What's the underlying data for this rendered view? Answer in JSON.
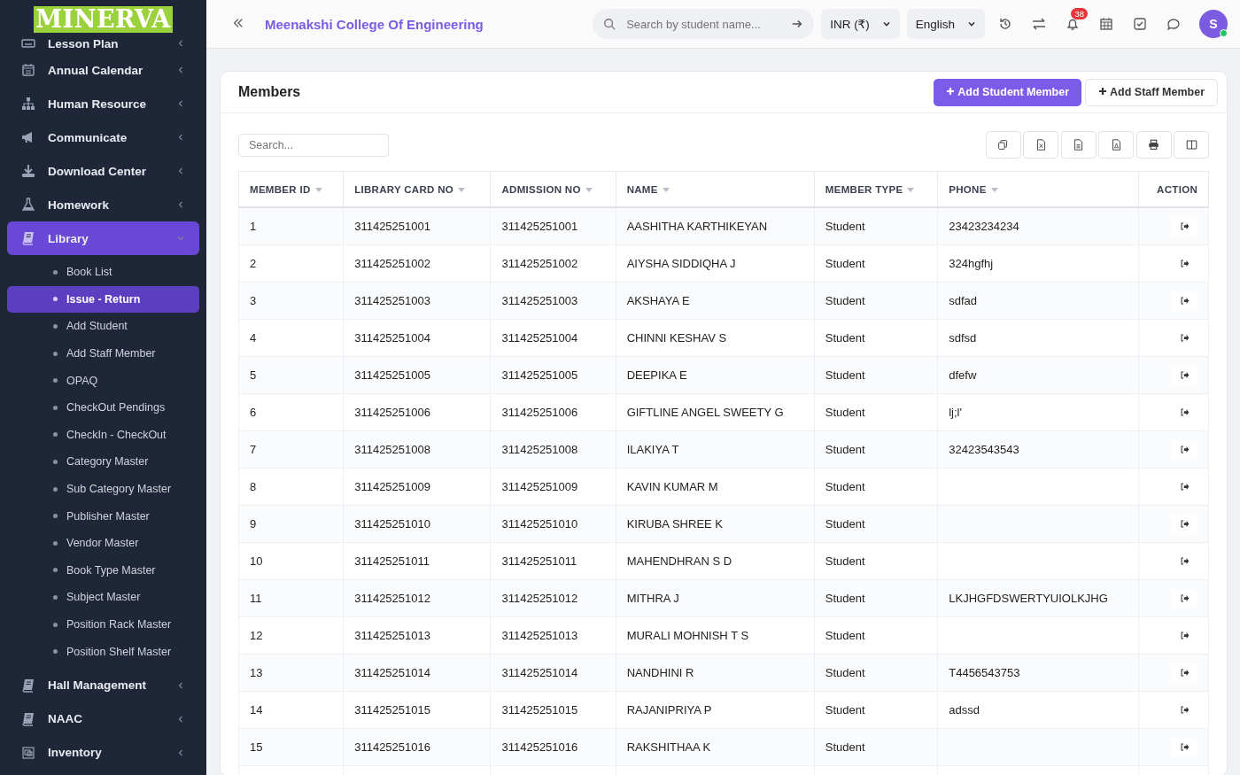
{
  "sidebar": {
    "logo": "MINERVA",
    "items": [
      {
        "label": "Lesson Plan",
        "expanded": false,
        "selected": false
      },
      {
        "label": "Annual Calendar",
        "expanded": false,
        "selected": false
      },
      {
        "label": "Human Resource",
        "expanded": false,
        "selected": false
      },
      {
        "label": "Communicate",
        "expanded": false,
        "selected": false
      },
      {
        "label": "Download Center",
        "expanded": false,
        "selected": false
      },
      {
        "label": "Homework",
        "expanded": false,
        "selected": false
      },
      {
        "label": "Library",
        "expanded": true,
        "selected": true,
        "children": [
          {
            "label": "Book List",
            "selected": false
          },
          {
            "label": "Issue - Return",
            "selected": true
          },
          {
            "label": "Add Student",
            "selected": false
          },
          {
            "label": "Add Staff Member",
            "selected": false
          },
          {
            "label": "OPAQ",
            "selected": false
          },
          {
            "label": "CheckOut Pendings",
            "selected": false
          },
          {
            "label": "CheckIn - CheckOut",
            "selected": false
          },
          {
            "label": "Category Master",
            "selected": false
          },
          {
            "label": "Sub Category Master",
            "selected": false
          },
          {
            "label": "Publisher Master",
            "selected": false
          },
          {
            "label": "Vendor Master",
            "selected": false
          },
          {
            "label": "Book Type Master",
            "selected": false
          },
          {
            "label": "Subject Master",
            "selected": false
          },
          {
            "label": "Position Rack Master",
            "selected": false
          },
          {
            "label": "Position Shelf Master",
            "selected": false
          }
        ]
      },
      {
        "label": "Hall Management",
        "expanded": false,
        "selected": false
      },
      {
        "label": "NAAC",
        "expanded": false,
        "selected": false
      },
      {
        "label": "Inventory",
        "expanded": false,
        "selected": false
      }
    ]
  },
  "topbar": {
    "title": "Meenakshi College Of Engineering",
    "search": {
      "placeholder": "Search by student name..."
    },
    "currency": "INR (₹)",
    "language": "English",
    "notifications": "38",
    "avatar": "S"
  },
  "card": {
    "title": "Members",
    "buttons": [
      {
        "label": "Add Student Member",
        "kind": "primary"
      },
      {
        "label": "Add Staff Member",
        "kind": "secondary"
      }
    ],
    "search": {
      "placeholder": "Search..."
    },
    "table": {
      "columns": [
        {
          "label": "MEMBER ID",
          "sortable": true
        },
        {
          "label": "LIBRARY CARD NO",
          "sortable": true
        },
        {
          "label": "ADMISSION NO",
          "sortable": true
        },
        {
          "label": "NAME",
          "sortable": true
        },
        {
          "label": "MEMBER TYPE",
          "sortable": true
        },
        {
          "label": "PHONE",
          "sortable": true
        },
        {
          "label": "ACTION",
          "sortable": false
        }
      ],
      "rows": [
        [
          "1",
          "311425251001",
          "311425251001",
          "AASHITHA KARTHIKEYAN",
          "Student",
          "23423234234"
        ],
        [
          "2",
          "311425251002",
          "311425251002",
          "AIYSHA SIDDIQHA J",
          "Student",
          "324hgfhj"
        ],
        [
          "3",
          "311425251003",
          "311425251003",
          "AKSHAYA E",
          "Student",
          "sdfad"
        ],
        [
          "4",
          "311425251004",
          "311425251004",
          "CHINNI KESHAV S",
          "Student",
          "sdfsd"
        ],
        [
          "5",
          "311425251005",
          "311425251005",
          "DEEPIKA E",
          "Student",
          "dfefw"
        ],
        [
          "6",
          "311425251006",
          "311425251006",
          "GIFTLINE ANGEL SWEETY G",
          "Student",
          "lj;l'"
        ],
        [
          "7",
          "311425251008",
          "311425251008",
          "ILAKIYA T",
          "Student",
          "32423543543"
        ],
        [
          "8",
          "311425251009",
          "311425251009",
          "KAVIN KUMAR M",
          "Student",
          ""
        ],
        [
          "9",
          "311425251010",
          "311425251010",
          "KIRUBA SHREE K",
          "Student",
          ""
        ],
        [
          "10",
          "311425251011",
          "311425251011",
          "MAHENDHRAN S D",
          "Student",
          ""
        ],
        [
          "11",
          "311425251012",
          "311425251012",
          "MITHRA J",
          "Student",
          "LKJHGFDSWERTYUIOLKJHG"
        ],
        [
          "12",
          "311425251013",
          "311425251013",
          "MURALI MOHNISH T S",
          "Student",
          ""
        ],
        [
          "13",
          "311425251014",
          "311425251014",
          "NANDHINI R",
          "Student",
          "T4456543753"
        ],
        [
          "14",
          "311425251015",
          "311425251015",
          "RAJANIPRIYA P",
          "Student",
          "adssd"
        ],
        [
          "15",
          "311425251016",
          "311425251016",
          "RAKSHITHAA K",
          "Student",
          ""
        ]
      ]
    }
  }
}
